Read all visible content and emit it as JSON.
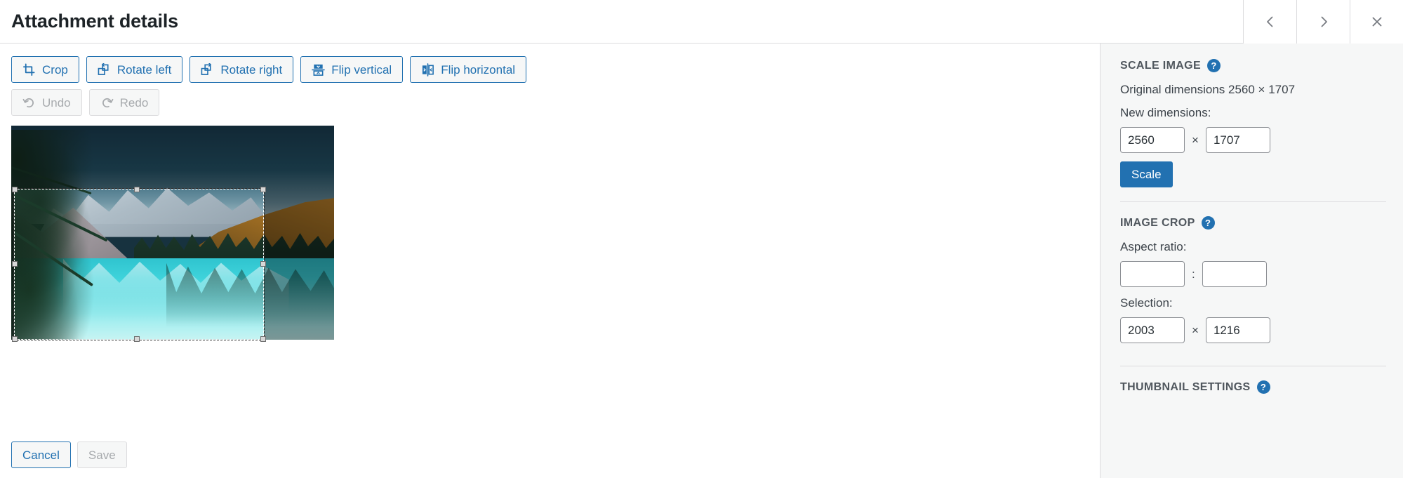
{
  "titlebar": {
    "title": "Attachment details",
    "prev_label": "‹",
    "next_label": "›",
    "close_label": "×"
  },
  "toolbar": {
    "row1": [
      {
        "label": "Crop",
        "icon": "crop-icon",
        "disabled": false
      },
      {
        "label": "Rotate left",
        "icon": "rotate-left-icon",
        "disabled": false
      },
      {
        "label": "Rotate right",
        "icon": "rotate-right-icon",
        "disabled": false
      },
      {
        "label": "Flip vertical",
        "icon": "flip-vertical-icon",
        "disabled": false
      },
      {
        "label": "Flip horizontal",
        "icon": "flip-horizontal-icon",
        "disabled": false
      }
    ],
    "row2": [
      {
        "label": "Undo",
        "icon": "undo-icon",
        "disabled": true
      },
      {
        "label": "Redo",
        "icon": "redo-icon",
        "disabled": true
      }
    ]
  },
  "footer": {
    "cancel_label": "Cancel",
    "save_label": "Save"
  },
  "sidebar": {
    "scale": {
      "heading": "SCALE IMAGE",
      "help_label": "?",
      "original_dimensions": "Original dimensions 2560 × 1707",
      "new_dimensions_label": "New dimensions:",
      "width": "2560",
      "height": "1707",
      "separator": "×",
      "scale_button": "Scale"
    },
    "crop": {
      "heading": "IMAGE CROP",
      "help_label": "?",
      "aspect_label": "Aspect ratio:",
      "aspect_w": "",
      "aspect_h": "",
      "aspect_separator": ":",
      "selection_label": "Selection:",
      "selection_w": "2003",
      "selection_h": "1216",
      "selection_separator": "×"
    },
    "thumbnail": {
      "heading": "THUMBNAIL SETTINGS",
      "help_label": "?"
    }
  },
  "colors": {
    "accent": "#2271b1",
    "sidebar_bg": "#f6f7f7",
    "border": "#dcdcde",
    "text": "#1d2327",
    "muted": "#a7aaad"
  }
}
